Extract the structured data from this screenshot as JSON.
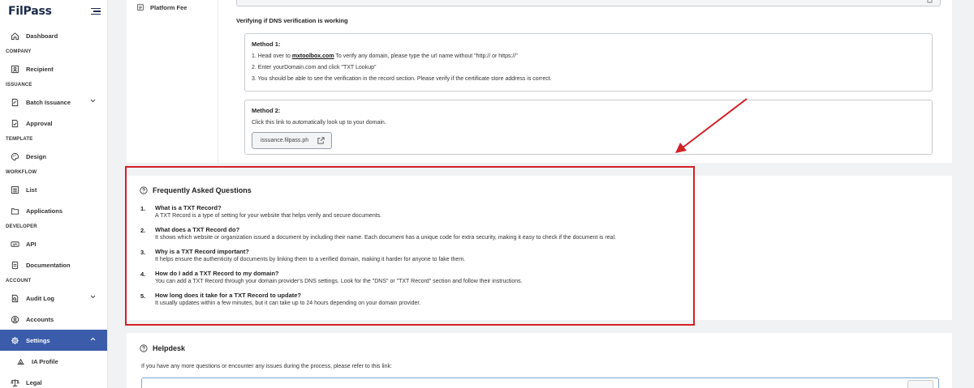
{
  "app": {
    "logo": "FilPass"
  },
  "sidebar": {
    "dashboard": "Dashboard",
    "company_section": "COMPANY",
    "recipient": "Recipient",
    "issuance_section": "ISSUANCE",
    "batch_issuance": "Batch Issuance",
    "approval": "Approval",
    "template_section": "TEMPLATE",
    "design": "Design",
    "workflow_section": "WORKFLOW",
    "list": "List",
    "applications": "Applications",
    "developer_section": "DEVELOPER",
    "api": "API",
    "documentation": "Documentation",
    "account_section": "ACCOUNT",
    "audit_log": "Audit Log",
    "accounts": "Accounts",
    "settings": "Settings",
    "ia_profile": "IA Profile",
    "legal": "Legal"
  },
  "settings_nav": {
    "platform_fee": "Platform Fee"
  },
  "verification": {
    "title": "Verifying if DNS verification is working",
    "method1": {
      "title": "Method 1:",
      "line1_prefix": "1. Head over to ",
      "line1_link": "mxtoolbox.com",
      "line1_suffix": " To verify any domain, please type the url name without \"http:// or https://\"",
      "line2": "2. Enter yourDomain.com and click \"TXT Lookup\"",
      "line3": "3. You should be able to see the verification in the record section. Please verify if the certificate store address is correct."
    },
    "method2": {
      "title": "Method 2:",
      "text": "Click this link to automatically look up to your domain.",
      "link_label": "issuance.filpass.ph"
    }
  },
  "faq": {
    "title": "Frequently Asked Questions",
    "items": [
      {
        "num": "1.",
        "q": "What is a TXT Record?",
        "a": "A TXT Record is a type of setting for your website that helps verify and secure documents."
      },
      {
        "num": "2.",
        "q": "What does a TXT Record do?",
        "a": "It shows which website or organization issued a document by including their name. Each document has a unique code for extra security, making it easy to check if the document is real."
      },
      {
        "num": "3.",
        "q": "Why is a TXT Record important?",
        "a": "It helps ensure the authenticity of documents by linking them to a verified domain, making it harder for anyone to fake them."
      },
      {
        "num": "4.",
        "q": "How do I add a TXT Record to my domain?",
        "a": "You can add a TXT Record through your domain provider's DNS settings. Look for the \"DNS\" or \"TXT Record\" section and follow their instructions."
      },
      {
        "num": "5.",
        "q": "How long does it take for a TXT Record to update?",
        "a": "It usually updates within a few minutes, but it can take up to 24 hours depending on your domain provider."
      }
    ]
  },
  "helpdesk": {
    "title": "Helpdesk",
    "text": "If you have any more questions or encounter any issues during the process, please refer to this link:"
  },
  "colors": {
    "accent": "#3b5cab",
    "annotation": "#d42027"
  }
}
